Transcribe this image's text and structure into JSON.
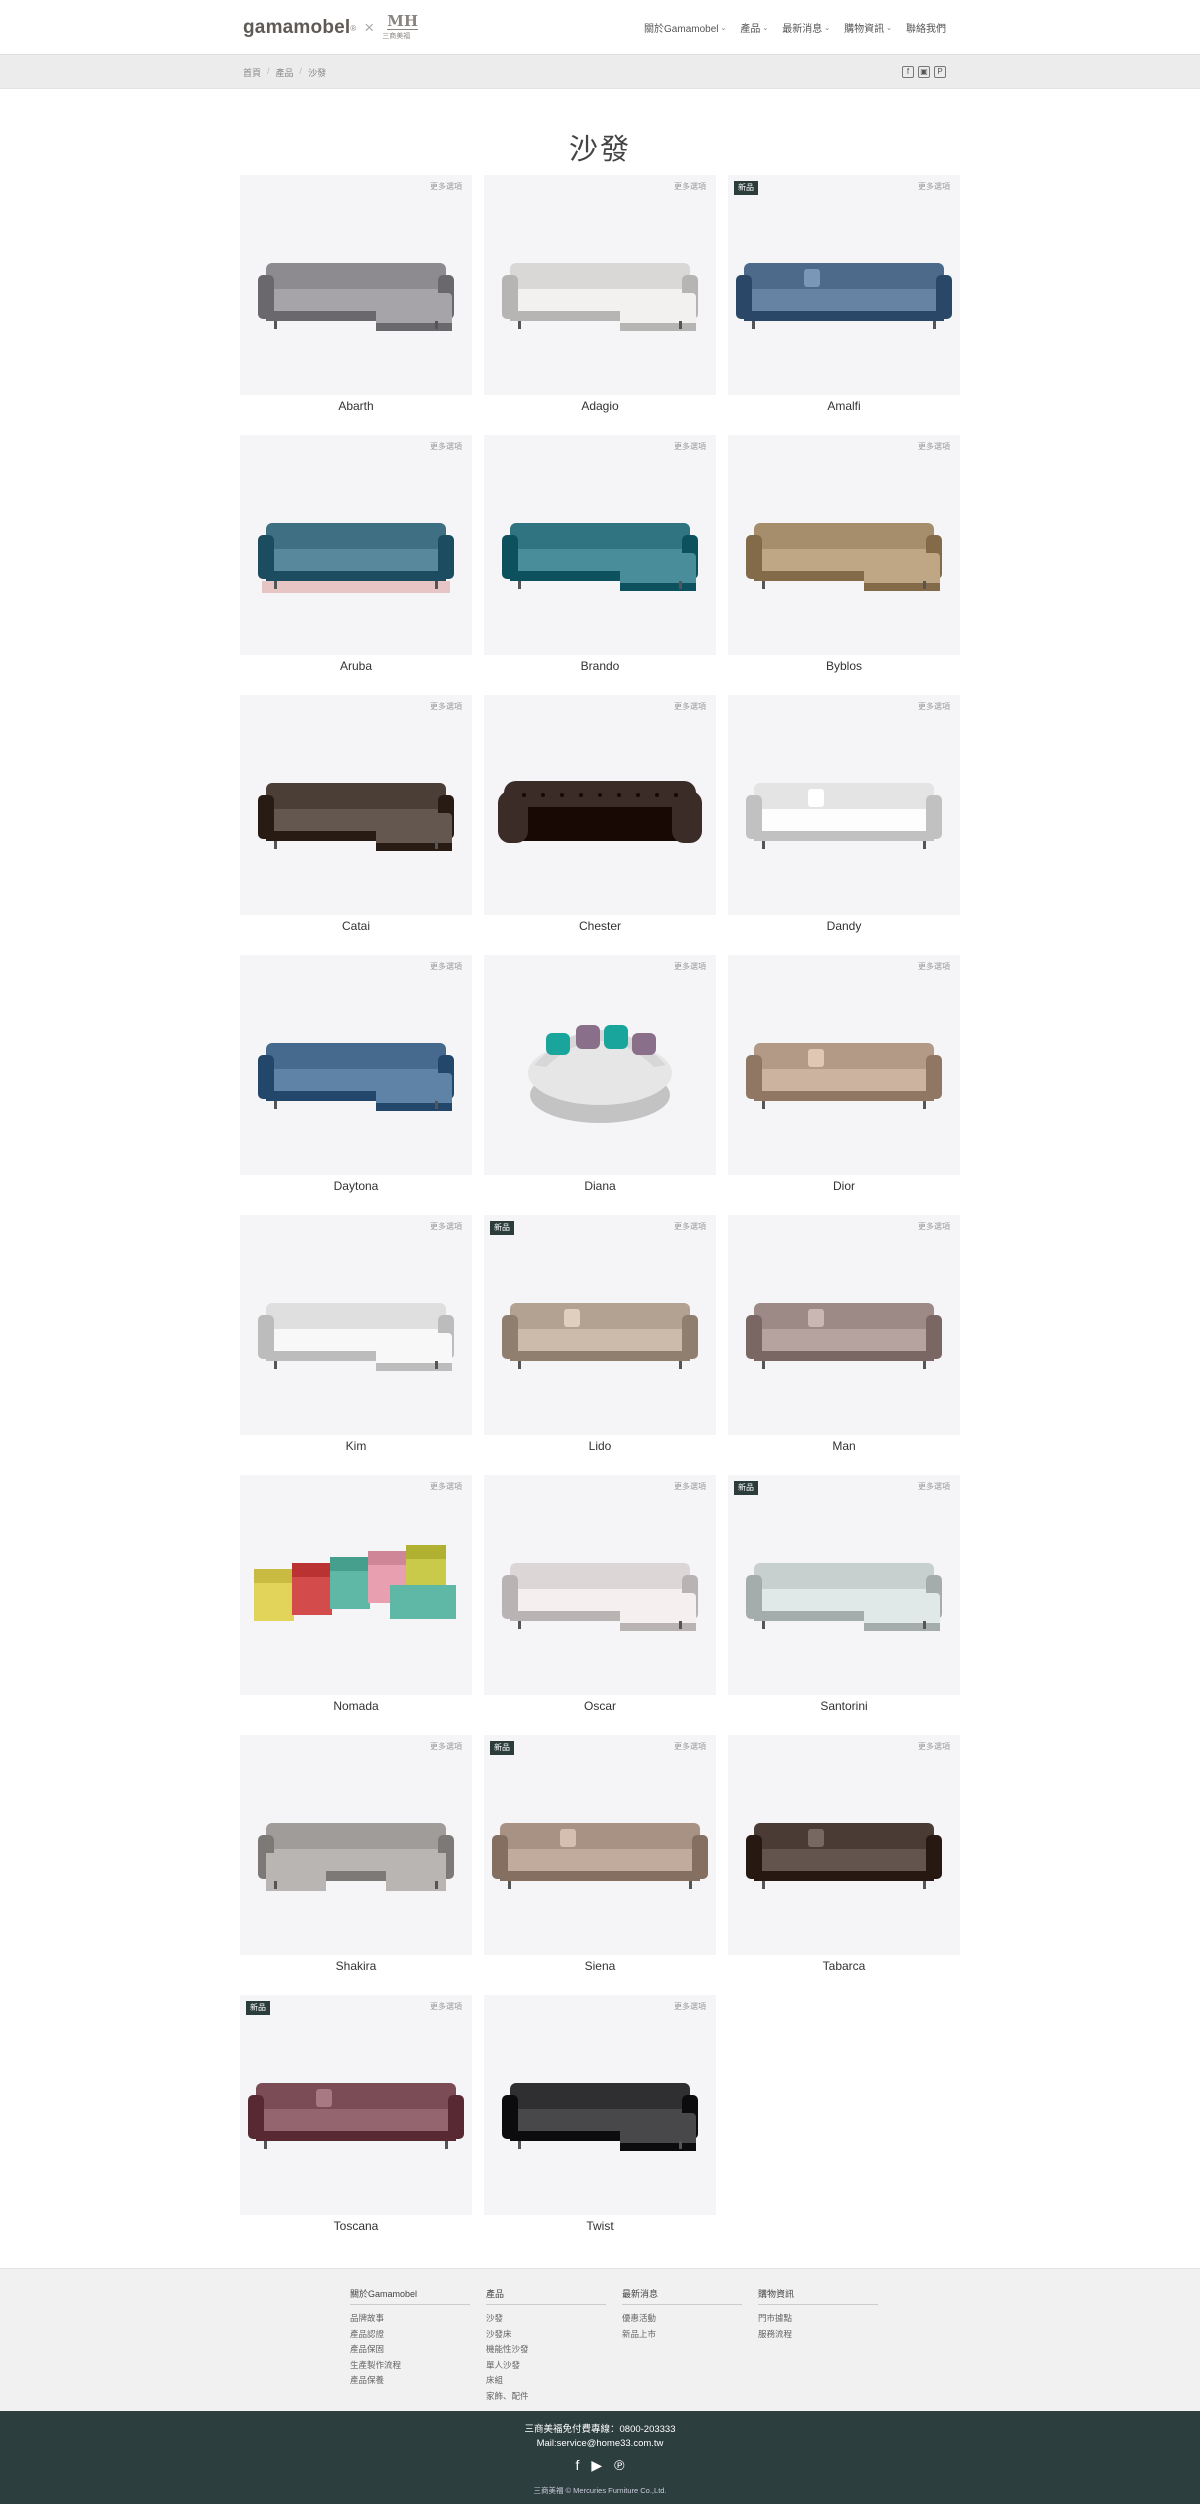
{
  "header": {
    "brand": "gamamobel",
    "brand_tm": "®",
    "separator": "×",
    "partner_mark": "MH",
    "partner_name": "三商美福",
    "nav": [
      {
        "label": "關於Gamamobel",
        "dropdown": true
      },
      {
        "label": "產品",
        "dropdown": true
      },
      {
        "label": "最新消息",
        "dropdown": true
      },
      {
        "label": "購物資訊",
        "dropdown": true
      },
      {
        "label": "聯絡我們",
        "dropdown": false
      }
    ],
    "caret": "⌄"
  },
  "breadcrumb": [
    "首頁",
    "產品",
    "沙發"
  ],
  "breadcrumb_sep": "/",
  "social_top": [
    "f",
    "▣",
    "P"
  ],
  "page_title": "沙發",
  "more_label": "更多選項",
  "new_label": "新品",
  "products": [
    {
      "name": "Abarth",
      "new": false,
      "color": "#8d8b8f",
      "shape": "sectional"
    },
    {
      "name": "Adagio",
      "new": false,
      "color": "#d9d8d6",
      "shape": "chaise"
    },
    {
      "name": "Amalfi",
      "new": true,
      "color": "#4d6a8a",
      "shape": "long"
    },
    {
      "name": "Aruba",
      "new": false,
      "color": "#3e6f82",
      "shape": "loveseat"
    },
    {
      "name": "Brando",
      "new": false,
      "color": "#2f7480",
      "shape": "chaise"
    },
    {
      "name": "Byblos",
      "new": false,
      "color": "#a68d6b",
      "shape": "sectional"
    },
    {
      "name": "Catai",
      "new": false,
      "color": "#4a3e37",
      "shape": "chaise"
    },
    {
      "name": "Chester",
      "new": false,
      "color": "#3c2c27",
      "shape": "chester"
    },
    {
      "name": "Dandy",
      "new": false,
      "color": "#e4e4e4",
      "shape": "sofa"
    },
    {
      "name": "Daytona",
      "new": false,
      "color": "#456a8e",
      "shape": "chaise"
    },
    {
      "name": "Diana",
      "new": false,
      "color": "#e6e6e6",
      "shape": "round"
    },
    {
      "name": "Dior",
      "new": false,
      "color": "#b39a86",
      "shape": "sofa"
    },
    {
      "name": "Kim",
      "new": false,
      "color": "#dfdfdf",
      "shape": "chaise"
    },
    {
      "name": "Lido",
      "new": true,
      "color": "#b3a291",
      "shape": "sofa"
    },
    {
      "name": "Man",
      "new": false,
      "color": "#9d8985",
      "shape": "sofa"
    },
    {
      "name": "Nomada",
      "new": false,
      "color": "#5fb7a6",
      "shape": "modular"
    },
    {
      "name": "Oscar",
      "new": false,
      "color": "#dcd7d6",
      "shape": "chaise"
    },
    {
      "name": "Santorini",
      "new": true,
      "color": "#c8cfcf",
      "shape": "chaise"
    },
    {
      "name": "Shakira",
      "new": false,
      "color": "#a09c99",
      "shape": "ushape"
    },
    {
      "name": "Siena",
      "new": true,
      "color": "#a89284",
      "shape": "long"
    },
    {
      "name": "Tabarca",
      "new": false,
      "color": "#4a3b35",
      "shape": "sofa"
    },
    {
      "name": "Toscana",
      "new": true,
      "color": "#7b4b56",
      "shape": "long"
    },
    {
      "name": "Twist",
      "new": false,
      "color": "#2f2f31",
      "shape": "chaise"
    }
  ],
  "footer": {
    "columns": [
      {
        "head": "關於Gamamobel",
        "links": [
          "品牌故事",
          "產品認證",
          "產品保固",
          "生產製作流程",
          "產品保養"
        ]
      },
      {
        "head": "產品",
        "links": [
          "沙發",
          "沙發床",
          "機能性沙發",
          "單人沙發",
          "床組",
          "家飾、配件"
        ]
      },
      {
        "head": "最新消息",
        "links": [
          "優惠活動",
          "新品上市"
        ]
      },
      {
        "head": "購物資訊",
        "links": [
          "門市據點",
          "服務流程"
        ]
      }
    ],
    "phone": "三商美福免付費專線：0800-203333",
    "mail": "Mail:service@home33.com.tw",
    "social": [
      "f",
      "▶",
      "℗"
    ],
    "copyright": "三商美福 © Mercuries Furniture Co.,Ltd."
  }
}
